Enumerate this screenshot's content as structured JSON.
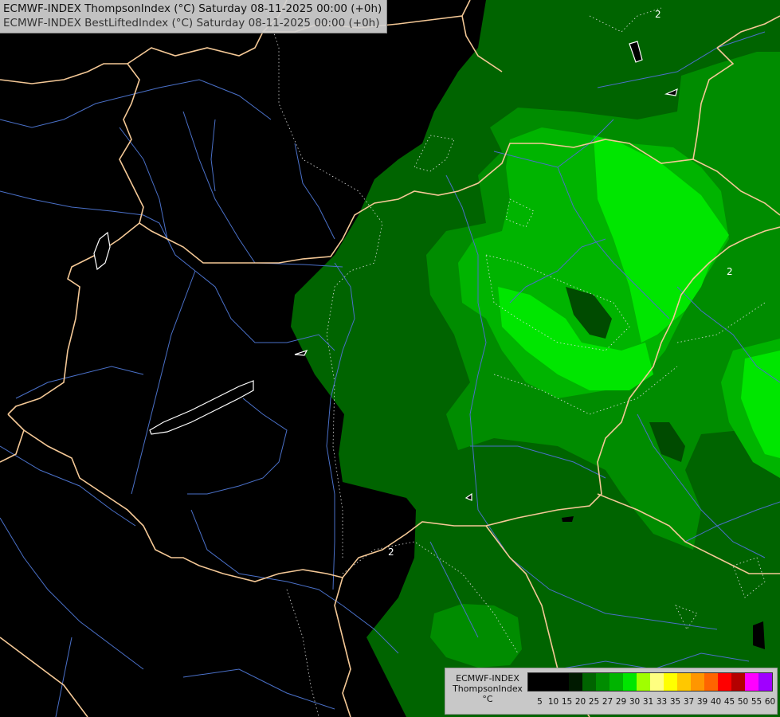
{
  "title": {
    "line1": "ECMWF-INDEX ThompsonIndex (°C) Saturday 08-11-2025 00:00 (+0h)",
    "line2": "ECMWF-INDEX BestLiftedIndex (°C) Saturday 08-11-2025 00:00 (+0h)"
  },
  "legend": {
    "line1": "ECMWF-INDEX",
    "line2": "ThompsonIndex",
    "line3": "°C",
    "ticks": [
      "5",
      "10",
      "15",
      "20",
      "25",
      "27",
      "29",
      "30",
      "31",
      "33",
      "35",
      "37",
      "39",
      "40",
      "45",
      "50",
      "55",
      "60"
    ],
    "colors": [
      "#000000",
      "#000000",
      "#000000",
      "#001a00",
      "#006400",
      "#008c00",
      "#00b400",
      "#00e600",
      "#a0ff00",
      "#ffff80",
      "#ffff00",
      "#ffc800",
      "#ff9600",
      "#ff6400",
      "#ff0000",
      "#b40000",
      "#ff00ff",
      "#a000ff",
      "#6000ff",
      "#0000ff"
    ]
  },
  "contour_labels": [
    "2",
    "2",
    "2"
  ],
  "colors": {
    "background": "#000000",
    "border": "#f4c896",
    "river": "#4a70c8",
    "lake_outline": "#ffffff",
    "fill_20_25": "#006400",
    "fill_25_27": "#008c00",
    "fill_27_29": "#00b400",
    "fill_29_30": "#00e600"
  }
}
